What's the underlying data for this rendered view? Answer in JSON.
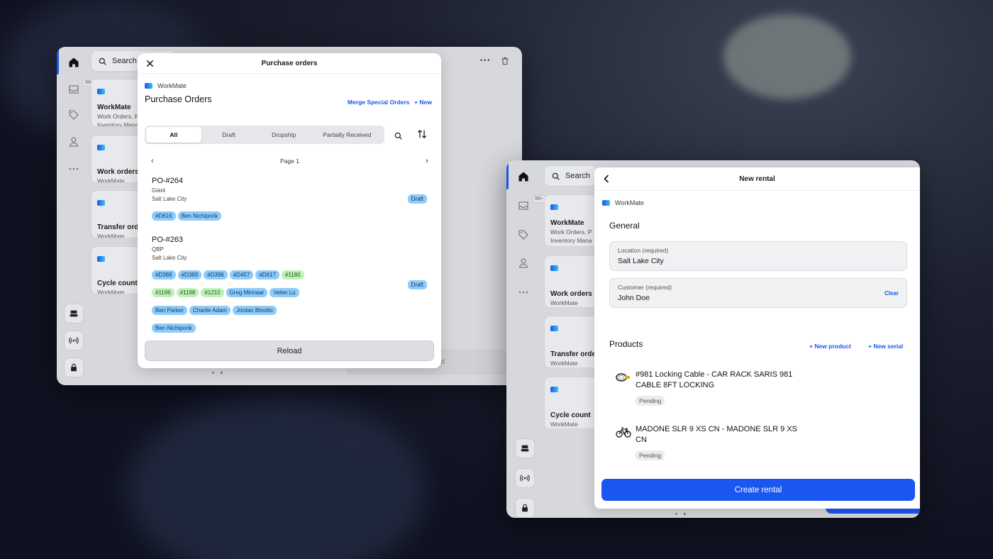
{
  "app": "WorkMate",
  "left_window": {
    "search_label": "Search",
    "inbox_badge": "99+",
    "cards": [
      {
        "title": "WorkMate",
        "lines": [
          "Work Orders, P",
          "Inventory Mana"
        ]
      },
      {
        "title": "Work orders",
        "lines": [
          "WorkMate"
        ]
      },
      {
        "title": "Transfer orde",
        "lines": [
          "WorkMate"
        ]
      },
      {
        "title": "Cycle count",
        "lines": [
          "WorkMate"
        ]
      }
    ],
    "behind_button_label": "ut",
    "pager_dots": "• +",
    "toolbar_more": "•••"
  },
  "purchase_modal": {
    "header_title": "Purchase orders",
    "app_name": "WorkMate",
    "page_title": "Purchase Orders",
    "merge_label": "Merge Special Orders",
    "new_label": "+ New",
    "tabs": [
      "All",
      "Draft",
      "Dropship",
      "Partially Received"
    ],
    "active_tab": "All",
    "page_label": "Page 1",
    "orders": [
      {
        "id": "PO-#264",
        "vendor": "Giant",
        "location": "Salt Lake City",
        "status": "Draft",
        "tag_rows": [
          [
            {
              "text": "#D616",
              "kind": "blue"
            },
            {
              "text": "Ben Nichiporik",
              "kind": "blue"
            }
          ]
        ]
      },
      {
        "id": "PO-#263",
        "vendor": "QBP",
        "location": "Salt Lake City",
        "status": "Draft",
        "tag_rows": [
          [
            {
              "text": "#D388",
              "kind": "blue"
            },
            {
              "text": "#D389",
              "kind": "blue"
            },
            {
              "text": "#D396",
              "kind": "blue"
            },
            {
              "text": "#D457",
              "kind": "blue"
            },
            {
              "text": "#D617",
              "kind": "blue"
            },
            {
              "text": "#1180",
              "kind": "green"
            }
          ],
          [
            {
              "text": "#1196",
              "kind": "green"
            },
            {
              "text": "#1198",
              "kind": "green"
            },
            {
              "text": "#1210",
              "kind": "green"
            },
            {
              "text": "Greg Minnaar",
              "kind": "blue"
            },
            {
              "text": "Velen Lu",
              "kind": "blue"
            }
          ],
          [
            {
              "text": "Ben Parker",
              "kind": "blue"
            },
            {
              "text": "Charlie Adam",
              "kind": "blue"
            },
            {
              "text": "Jordan Binotto",
              "kind": "blue"
            }
          ],
          [
            {
              "text": "Ben Nichiporik",
              "kind": "blue"
            }
          ]
        ]
      }
    ],
    "reload_label": "Reload"
  },
  "right_window": {
    "search_label": "Search",
    "inbox_badge": "99+",
    "cards": [
      {
        "title": "WorkMate",
        "lines": [
          "Work Orders, P",
          "Inventory Mana"
        ]
      },
      {
        "title": "Work orders",
        "lines": [
          "WorkMate"
        ]
      },
      {
        "title": "Transfer orde",
        "lines": [
          "WorkMate"
        ]
      },
      {
        "title": "Cycle count",
        "lines": [
          "WorkMate"
        ]
      }
    ],
    "pager_dots": "• +"
  },
  "rental_modal": {
    "header_title": "New rental",
    "app_name": "WorkMate",
    "section_general": "General",
    "location_label": "Location (required)",
    "location_value": "Salt Lake City",
    "customer_label": "Customer (required)",
    "customer_value": "John Doe",
    "clear_label": "Clear",
    "section_products": "Products",
    "new_product_label": "+ New product",
    "new_serial_label": "+ New serial",
    "products": [
      {
        "name": "#981 Locking Cable - CAR RACK SARIS 981 CABLE 8FT LOCKING",
        "status": "Pending",
        "icon": "cable-lock-icon"
      },
      {
        "name": "MADONE SLR 9 XS CN - MADONE SLR 9 XS CN",
        "status": "Pending",
        "icon": "bicycle-icon"
      }
    ],
    "create_label": "Create rental"
  },
  "colors": {
    "accent": "#1a56f0",
    "tag_blue": "#8fcbf9",
    "tag_green": "#bff0b8"
  }
}
